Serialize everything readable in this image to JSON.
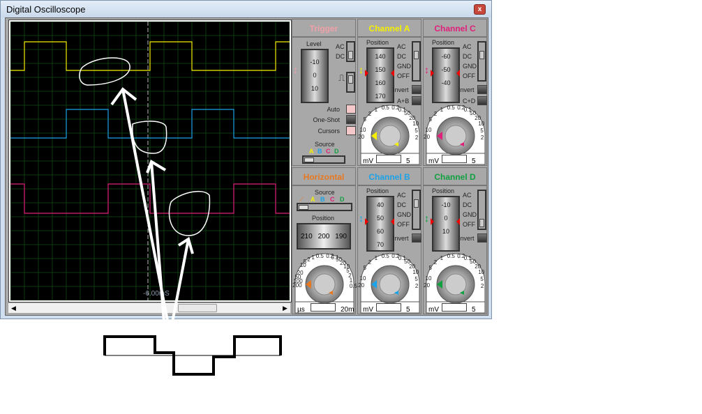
{
  "window": {
    "title": "Digital Oscilloscope",
    "close": "x"
  },
  "screen": {
    "cursor_readout": "-6.00mS"
  },
  "colors": {
    "A": "#f5f000",
    "B": "#1aa3e8",
    "C": "#e0207a",
    "D": "#10a040",
    "horizontal": "#e87820",
    "trigger": "#f0a0a8"
  },
  "trigger": {
    "title": "Trigger",
    "level_label": "Level",
    "ticks": [
      "-10",
      "0",
      "10"
    ],
    "ac": "AC",
    "dc": "DC",
    "auto": "Auto",
    "one_shot": "One-Shot",
    "cursors": "Cursors",
    "source_label": "Source",
    "sources": [
      "A",
      "B",
      "C",
      "D"
    ]
  },
  "horizontal": {
    "title": "Horizontal",
    "source_label": "Source",
    "sources": [
      "A",
      "B",
      "C",
      "D"
    ],
    "position_label": "Position",
    "ticks": [
      "210",
      "200",
      "190"
    ],
    "dial_left": [
      "0.5",
      "1",
      "2",
      "5",
      "10",
      "20",
      "50",
      "100",
      "200"
    ],
    "dial_right": [
      "0.2",
      "0.1",
      "50",
      "20",
      "10",
      "5",
      "2",
      "1",
      "0.5"
    ],
    "unit_left": "ms",
    "unit_right": "µs",
    "value": "20m"
  },
  "channels": [
    {
      "key": "A",
      "title": "Channel A",
      "ticks": [
        "140",
        "150",
        "160",
        "170"
      ],
      "extra": "A+B",
      "value": "5"
    },
    {
      "key": "C",
      "title": "Channel C",
      "ticks": [
        "-60",
        "-50",
        "-40",
        ""
      ],
      "extra": "C+D",
      "value": "5"
    },
    {
      "key": "B",
      "title": "Channel B",
      "ticks": [
        "40",
        "50",
        "60",
        "70"
      ],
      "extra": "",
      "value": "5"
    },
    {
      "key": "D",
      "title": "Channel D",
      "ticks": [
        "-10",
        "0",
        "10",
        ""
      ],
      "extra": "",
      "value": "5"
    }
  ],
  "channel_common": {
    "position_label": "Position",
    "coupling": [
      "AC",
      "DC",
      "GND",
      "OFF"
    ],
    "invert": "Invert",
    "dial_left": [
      "0.5",
      "1",
      "2",
      "5",
      "10",
      "20"
    ],
    "dial_right": [
      "0.2",
      "0.1",
      "50",
      "20",
      "10",
      "5",
      "2"
    ],
    "unit_left": "V",
    "unit_right": "mV"
  }
}
